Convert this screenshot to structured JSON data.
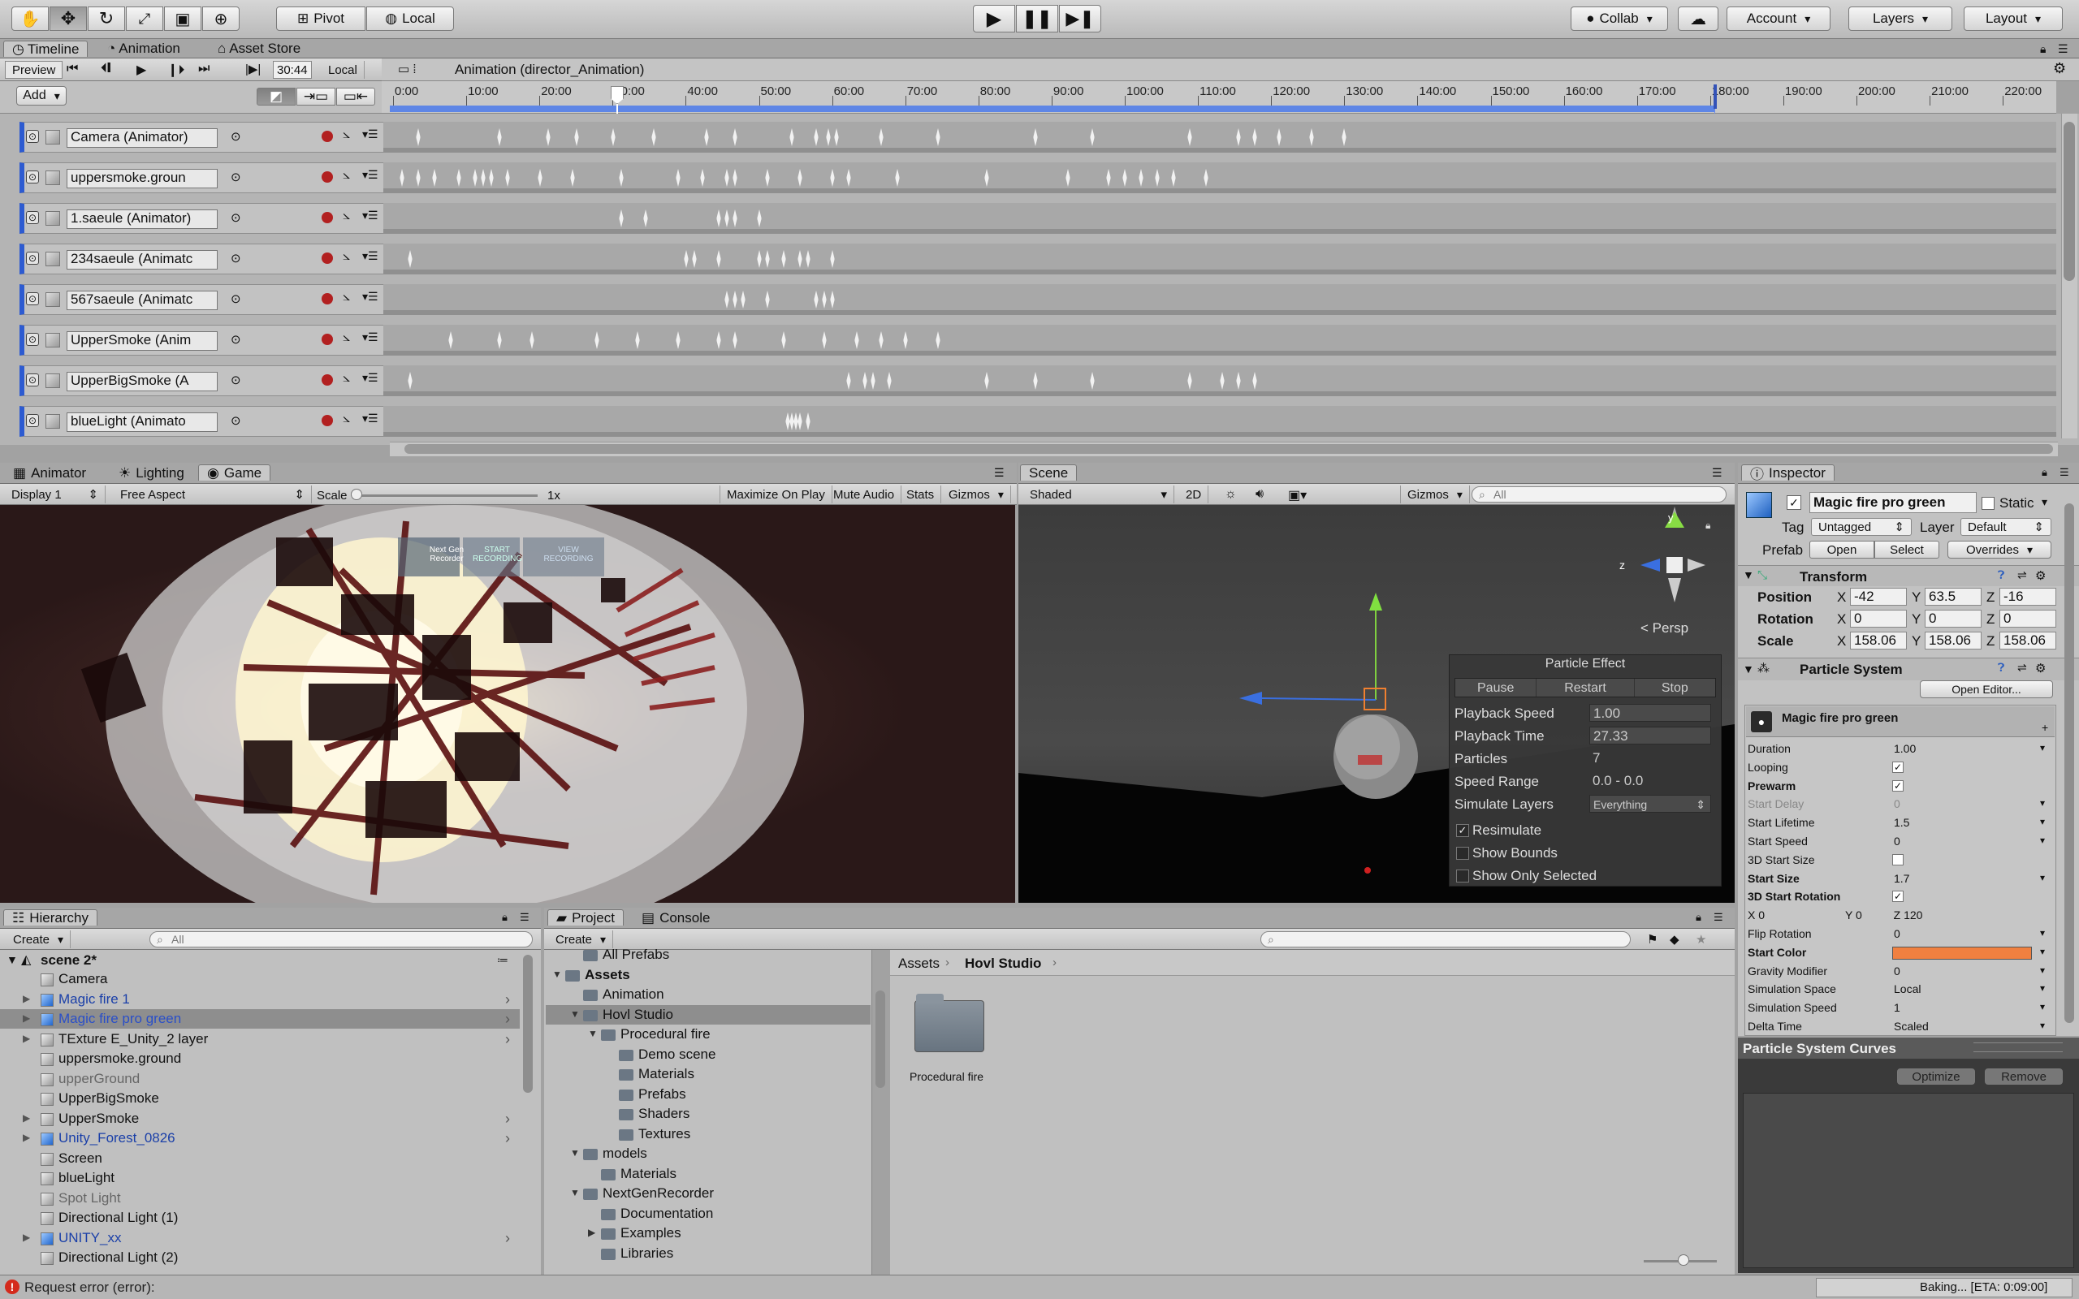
{
  "main_toolbar": {
    "pivot": "Pivot",
    "local": "Local",
    "collab": "Collab",
    "account": "Account",
    "layers": "Layers",
    "layout": "Layout"
  },
  "timeline": {
    "tabs": [
      "Timeline",
      "Animation",
      "Asset Store"
    ],
    "preview": "Preview",
    "frame": "30:44",
    "local": "Local",
    "title": "Animation (director_Animation)",
    "add": "Add",
    "ticks": [
      "0:00",
      "10:00",
      "20:00",
      "30:00",
      "40:00",
      "50:00",
      "60:00",
      "70:00",
      "80:00",
      "90:00",
      "100:00",
      "110:00",
      "120:00",
      "130:00",
      "140:00",
      "150:00",
      "160:00",
      "170:00",
      "180:00",
      "190:00",
      "200:00",
      "210:00",
      "220:00"
    ],
    "tracks": [
      "Camera (Animator)",
      "uppersmoke.groun",
      "1.saeule (Animator)",
      "234saeule (Animatc",
      "567saeule (Animatc",
      "UpperSmoke (Anim",
      "UpperBigSmoke  (A",
      "blueLight (Animato"
    ]
  },
  "game": {
    "tabs": [
      "Animator",
      "Lighting",
      "Game"
    ],
    "display": "Display 1",
    "aspect": "Free Aspect",
    "scale_label": "Scale",
    "scale_value": "1x",
    "maximize": "Maximize On Play",
    "mute": "Mute Audio",
    "stats": "Stats",
    "gizmos": "Gizmos",
    "overlay": [
      "Next Gen Recorder",
      "START RECORDING",
      "VIEW RECORDING"
    ]
  },
  "scene": {
    "tab": "Scene",
    "shading": "Shaded",
    "mode2d": "2D",
    "gizmos": "Gizmos",
    "search": "All",
    "persp": "< Persp",
    "axis_y": "y",
    "axis_z": "z",
    "particle_panel": {
      "title": "Particle Effect",
      "pause": "Pause",
      "restart": "Restart",
      "stop": "Stop",
      "rows": [
        {
          "label": "Playback Speed",
          "value": "1.00"
        },
        {
          "label": "Playback Time",
          "value": "27.33"
        },
        {
          "label": "Particles",
          "value": "7"
        },
        {
          "label": "Speed Range",
          "value": "0.0 - 0.0"
        },
        {
          "label": "Simulate Layers",
          "value": "Everything"
        }
      ],
      "checks": [
        "Resimulate",
        "Show Bounds",
        "Show Only Selected"
      ]
    }
  },
  "inspector": {
    "tab": "Inspector",
    "object_name": "Magic fire pro green",
    "static": "Static",
    "tag_label": "Tag",
    "tag_value": "Untagged",
    "layer_label": "Layer",
    "layer_value": "Default",
    "prefab_label": "Prefab",
    "open": "Open",
    "select": "Select",
    "overrides": "Overrides",
    "transform_title": "Transform",
    "position": {
      "label": "Position",
      "x": "-42",
      "y": "63.5",
      "z": "-16"
    },
    "rotation": {
      "label": "Rotation",
      "x": "0",
      "y": "0",
      "z": "0"
    },
    "scale": {
      "label": "Scale",
      "x": "158.06",
      "y": "158.06",
      "z": "158.06"
    },
    "ps_title": "Particle System",
    "open_editor": "Open Editor...",
    "module_name": "Magic fire pro green",
    "props": [
      {
        "label": "Duration",
        "value": "1.00",
        "bold": false
      },
      {
        "label": "Looping",
        "value": "✓",
        "bold": false
      },
      {
        "label": "Prewarm",
        "value": "✓",
        "bold": true
      },
      {
        "label": "Start Delay",
        "value": "0",
        "bold": false,
        "dim": true
      },
      {
        "label": "Start Lifetime",
        "value": "1.5",
        "bold": false
      },
      {
        "label": "Start Speed",
        "value": "0",
        "bold": false
      },
      {
        "label": "3D Start Size",
        "value": "",
        "bold": false
      },
      {
        "label": "Start Size",
        "value": "1.7",
        "bold": true
      },
      {
        "label": "3D Start Rotation",
        "value": "✓",
        "bold": true
      },
      {
        "label": "X 0",
        "value": "Y 0          Z 120",
        "bold": false
      },
      {
        "label": "Flip Rotation",
        "value": "0",
        "bold": false
      },
      {
        "label": "Start Color",
        "value": "",
        "bold": true
      },
      {
        "label": "Gravity Modifier",
        "value": "0",
        "bold": false
      },
      {
        "label": "Simulation Space",
        "value": "Local",
        "bold": false
      },
      {
        "label": "Simulation Speed",
        "value": "1",
        "bold": false
      },
      {
        "label": "Delta Time",
        "value": "Scaled",
        "bold": false
      }
    ],
    "start_color": "#f08040",
    "curves_title": "Particle System Curves",
    "optimize": "Optimize",
    "remove": "Remove"
  },
  "hierarchy": {
    "tab": "Hierarchy",
    "create": "Create",
    "search": "All",
    "scene_name": "scene 2*",
    "items": [
      {
        "label": "Camera",
        "indent": 1,
        "color": "#111",
        "arrow": false,
        "icon": "gray"
      },
      {
        "label": "Magic fire 1",
        "indent": 1,
        "color": "#1a3fa8",
        "arrow": true,
        "icon": "blue"
      },
      {
        "label": "Magic fire pro green",
        "indent": 1,
        "color": "#1a3fa8",
        "arrow": true,
        "icon": "blue",
        "selected": true
      },
      {
        "label": "TExture E_Unity_2 layer",
        "indent": 1,
        "color": "#111",
        "arrow": true,
        "icon": "gray"
      },
      {
        "label": "uppersmoke.ground",
        "indent": 1,
        "color": "#111",
        "arrow": false,
        "icon": "gray"
      },
      {
        "label": "upperGround",
        "indent": 1,
        "color": "#666",
        "arrow": false,
        "icon": "gray"
      },
      {
        "label": "UpperBigSmoke",
        "indent": 1,
        "color": "#111",
        "arrow": false,
        "icon": "gray"
      },
      {
        "label": "UpperSmoke",
        "indent": 1,
        "color": "#111",
        "arrow": true,
        "icon": "gray"
      },
      {
        "label": "Unity_Forest_0826",
        "indent": 1,
        "color": "#1a3fa8",
        "arrow": true,
        "icon": "blue"
      },
      {
        "label": "Screen",
        "indent": 1,
        "color": "#111",
        "arrow": false,
        "icon": "gray"
      },
      {
        "label": "blueLight",
        "indent": 1,
        "color": "#111",
        "arrow": false,
        "icon": "gray"
      },
      {
        "label": "Spot Light",
        "indent": 1,
        "color": "#666",
        "arrow": false,
        "icon": "gray"
      },
      {
        "label": "Directional Light (1)",
        "indent": 1,
        "color": "#111",
        "arrow": false,
        "icon": "gray"
      },
      {
        "label": "UNITY_xx",
        "indent": 1,
        "color": "#1a3fa8",
        "arrow": true,
        "icon": "blue"
      },
      {
        "label": "Directional Light (2)",
        "indent": 1,
        "color": "#111",
        "arrow": false,
        "icon": "gray"
      }
    ]
  },
  "project": {
    "tabs": [
      "Project",
      "Console"
    ],
    "create": "Create",
    "tree": [
      {
        "label": "All Prefabs",
        "depth": 1,
        "arrow": ""
      },
      {
        "label": "Assets",
        "depth": 0,
        "arrow": "▼",
        "bold": true
      },
      {
        "label": "Animation",
        "depth": 1,
        "arrow": ""
      },
      {
        "label": "Hovl Studio",
        "depth": 1,
        "arrow": "▼",
        "selected": true
      },
      {
        "label": "Procedural fire",
        "depth": 2,
        "arrow": "▼"
      },
      {
        "label": "Demo scene",
        "depth": 3,
        "arrow": ""
      },
      {
        "label": "Materials",
        "depth": 3,
        "arrow": ""
      },
      {
        "label": "Prefabs",
        "depth": 3,
        "arrow": ""
      },
      {
        "label": "Shaders",
        "depth": 3,
        "arrow": ""
      },
      {
        "label": "Textures",
        "depth": 3,
        "arrow": ""
      },
      {
        "label": "models",
        "depth": 1,
        "arrow": "▼"
      },
      {
        "label": "Materials",
        "depth": 2,
        "arrow": ""
      },
      {
        "label": "NextGenRecorder",
        "depth": 1,
        "arrow": "▼"
      },
      {
        "label": "Documentation",
        "depth": 2,
        "arrow": ""
      },
      {
        "label": "Examples",
        "depth": 2,
        "arrow": "▶"
      },
      {
        "label": "Libraries",
        "depth": 2,
        "arrow": ""
      }
    ],
    "breadcrumb": [
      "Assets",
      "Hovl Studio"
    ],
    "folder_item": "Procedural fire"
  },
  "status": {
    "error": "Request error (error):",
    "baking": "Baking... [ETA: 0:09:00]"
  }
}
